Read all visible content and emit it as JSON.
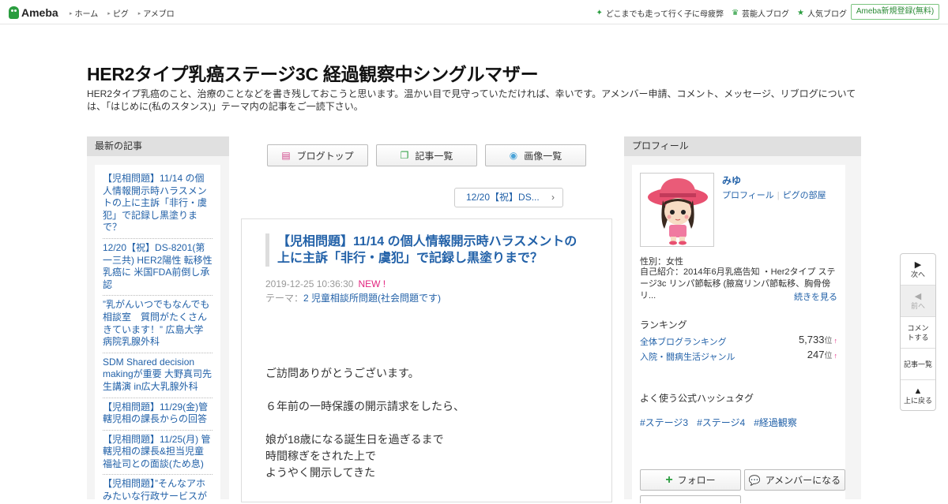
{
  "topbar": {
    "logo": "Ameba",
    "nav": [
      "ホーム",
      "ピグ",
      "アメブロ"
    ],
    "right_links": [
      {
        "icon": "sparkle-icon",
        "label": "どこまでも走って行く子に母疲弊"
      },
      {
        "icon": "crown-icon",
        "label": "芸能人ブログ"
      },
      {
        "icon": "star-icon",
        "label": "人気ブログ"
      }
    ],
    "register": "Ameba新規登録(無料)"
  },
  "blog": {
    "title": "HER2タイプ乳癌ステージ3C 経過観察中シングルマザー",
    "description": "HER2タイプ乳癌のこと、治療のことなどを書き残しておこうと思います。温かい目で見守っていただければ、幸いです。アメンバー申請、コメント、メッセージ、リブログについては、「はじめに(私のスタンス)」テーマ内の記事をご一読下さい。"
  },
  "left": {
    "heading": "最新の記事",
    "items": [
      "【児相問題】11/14 の個人情報開示時ハラスメントの上に主訴「非行・虞犯」で記録し黒塗りまで？",
      "12/20【祝】DS-8201(第一三共) HER2陽性 転移性乳癌に 米国FDA前倒し承認",
      "”乳がんいつでもなんでも相談室　質問がたくさんきています！” 広島大学病院乳腺外科",
      "SDM Shared decision makingが重要 大野真司先生講演 in広大乳腺外科",
      "【児相問題】11/29(金)管轄児相の課長からの回答",
      "【児相問題】11/25(月) 管轄児相の課長&担当児童福祉司との面談(ため息)",
      "【児相問題】”そんなアホみたいな行政サービスが"
    ]
  },
  "center": {
    "buttons": [
      {
        "icon": "document-icon",
        "label": "ブログトップ"
      },
      {
        "icon": "copy-icon",
        "label": "記事一覧"
      },
      {
        "icon": "camera-icon",
        "label": "画像一覧"
      }
    ],
    "prev_article": "12/20【祝】DS...",
    "article": {
      "title": "【児相問題】11/14 の個人情報開示時ハラスメントの上に主訴「非行・虞犯」で記録し黒塗りまで？",
      "date": "2019-12-25 10:36:30",
      "new_badge": "NEW !",
      "theme_label": "テーマ：",
      "theme": "2 児童相談所問題(社会問題です)",
      "body": [
        "ご訪問ありがとうございます。",
        "",
        "６年前の一時保護の開示請求をしたら、",
        "",
        "娘が18歳になる誕生日を過ぎるまで",
        "時間稼ぎをされた上で",
        "ようやく開示してきた"
      ]
    }
  },
  "right": {
    "heading": "プロフィール",
    "name": "みゆ",
    "link_profile": "プロフィール",
    "link_pig": "ピグの部屋",
    "gender": "性別：女性",
    "intro": "自己紹介：2014年6月乳癌告知 ・Her2タイプ ステージ3c リンパ節転移 (腋窩リンパ節転移、胸骨傍リ...",
    "read_more": "続きを見る",
    "ranking_heading": "ランキング",
    "rankings": [
      {
        "label": "全体ブログランキング",
        "value": "5,733",
        "unit": "位",
        "trend": "↑"
      },
      {
        "label": "入院・闘病生活ジャンル",
        "value": "247",
        "unit": "位",
        "trend": "↑"
      }
    ],
    "hashtag_heading": "よく使う公式ハッシュタグ",
    "hashtags": [
      "#ステージ3",
      "#ステージ4",
      "#経過観察"
    ],
    "follow": "フォロー",
    "amember": "アメンバーになる"
  },
  "sidenav": [
    {
      "icon": "play-icon",
      "glyph": "▶",
      "label": "次へ",
      "disabled": false
    },
    {
      "icon": "back-icon",
      "glyph": "◀",
      "label": "前へ",
      "disabled": true
    },
    {
      "icon": "",
      "glyph": "",
      "label": "コメントする",
      "disabled": false
    },
    {
      "icon": "",
      "glyph": "",
      "label": "記事一覧",
      "disabled": false
    },
    {
      "icon": "up-icon",
      "glyph": "▲",
      "label": "上に戻る",
      "disabled": false
    }
  ],
  "colors": {
    "accent_green": "#2a9d3f",
    "link_blue": "#2261a8",
    "new_pink": "#e2247f"
  }
}
